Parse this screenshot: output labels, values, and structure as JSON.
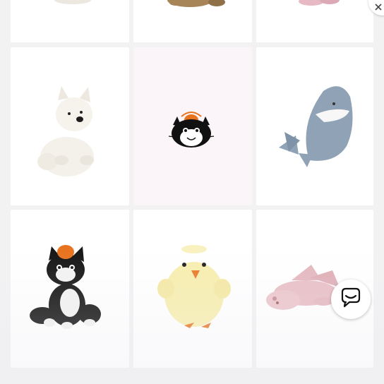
{
  "products": [
    {
      "name": "product-card-top-left",
      "icon": "plush-partial-icon"
    },
    {
      "name": "product-card-top-middle",
      "icon": "bear-plush-partial-icon"
    },
    {
      "name": "product-card-top-right",
      "icon": "pink-plush-partial-icon"
    },
    {
      "name": "product-card-westie-dog",
      "icon": "white-terrier-plush-icon"
    },
    {
      "name": "product-card-brand-placeholder",
      "icon": "black-cat-logo-icon"
    },
    {
      "name": "product-card-shark",
      "icon": "grey-shark-plush-icon"
    },
    {
      "name": "product-card-black-cat",
      "icon": "black-cat-plush-icon"
    },
    {
      "name": "product-card-yellow-chick",
      "icon": "yellow-chick-plush-icon"
    },
    {
      "name": "product-card-pink-dragon",
      "icon": "pink-dragon-plush-icon"
    }
  ],
  "chat": {
    "icon": "chat-bubble-icon"
  },
  "colors": {
    "page_background": "#f2f2f3",
    "card_background": "#ffffff",
    "brand_card_background": "#fbf4f8",
    "cat_orange": "#e8731e"
  }
}
